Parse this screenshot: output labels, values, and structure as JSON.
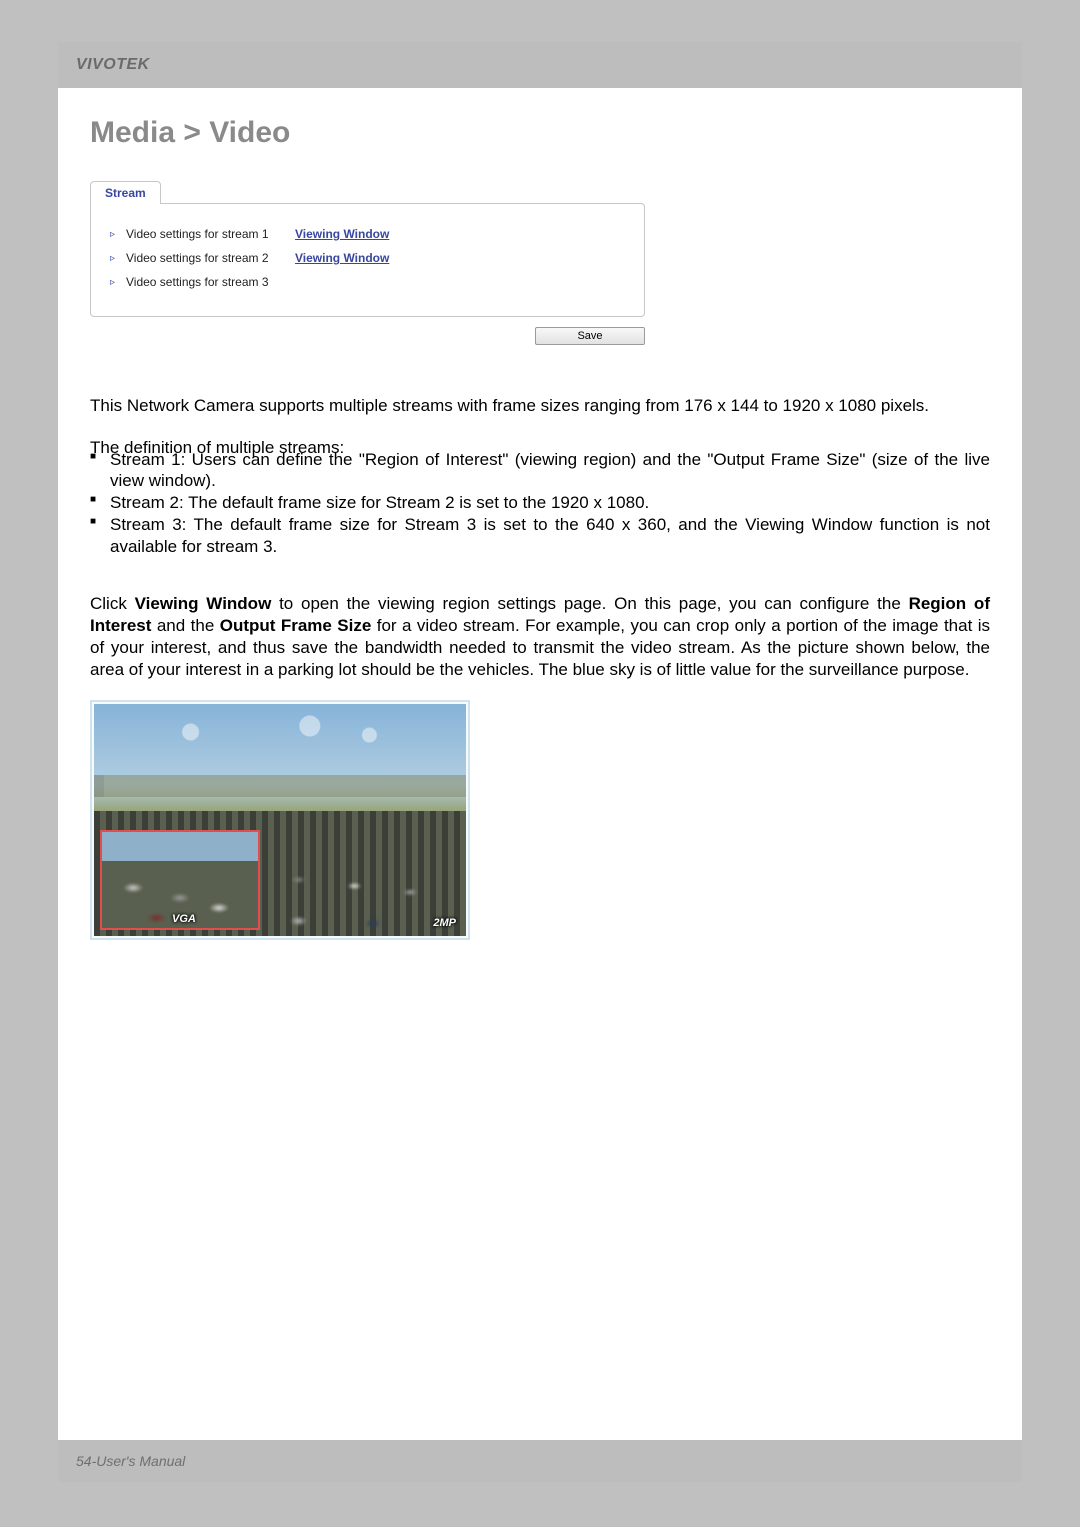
{
  "brand": "VIVOTEK",
  "breadcrumb_title": "Media > Video",
  "ui": {
    "tab_label": "Stream",
    "rows": [
      {
        "label": "Video settings for stream 1",
        "link": "Viewing Window"
      },
      {
        "label": "Video settings for stream 2",
        "link": "Viewing Window"
      },
      {
        "label": "Video settings for stream 3",
        "link": ""
      }
    ],
    "save_label": "Save"
  },
  "body": {
    "p1": "This Network Camera supports multiple streams with frame sizes ranging from 176 x 144 to 1920 x 1080 pixels.",
    "p2": "The definition of multiple streams:",
    "bullets": [
      "Stream 1: Users can define the \"Region of Interest\" (viewing region) and the \"Output Frame Size\" (size of the live view window).",
      "Stream 2: The default frame size for Stream 2 is set to the 1920 x 1080.",
      "Stream 3: The default frame size for Stream 3 is set to the 640 x 360, and the Viewing Window function is not available for stream 3."
    ],
    "p3_pre": "Click ",
    "p3_bold1": "Viewing Window",
    "p3_mid1": " to open the viewing region settings page. On this page, you can configure the ",
    "p3_bold2": "Region of Interest",
    "p3_mid2": " and the ",
    "p3_bold3": "Output Frame Size",
    "p3_post": " for a video stream.  For example, you can crop only a portion of the image that is of your interest, and thus save the bandwidth needed to transmit the video stream. As the picture shown below, the area of your interest in a parking lot should be the vehicles. The blue sky is of little value for the surveillance purpose."
  },
  "figure": {
    "badge_vga": "VGA",
    "badge_2mp": "2MP"
  },
  "footer": {
    "page_num": "54",
    "sep": " - ",
    "doc": "User's Manual"
  }
}
